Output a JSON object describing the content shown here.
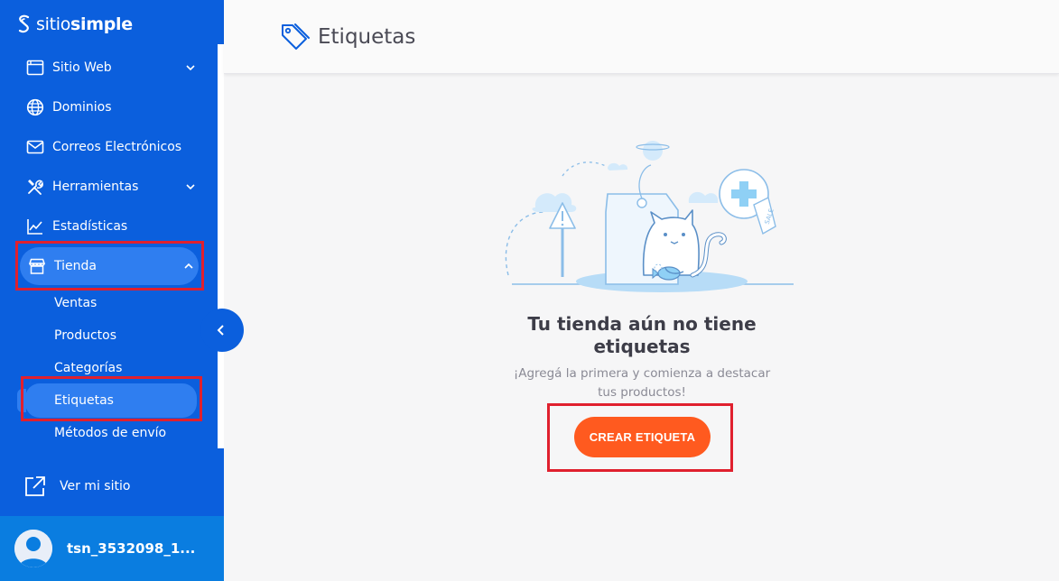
{
  "brand": {
    "prefix": "sitio",
    "bold": "simple"
  },
  "sidebar": {
    "items": [
      {
        "label": "Sitio Web",
        "icon": "browser-window-icon",
        "has_chevron": true
      },
      {
        "label": "Dominios",
        "icon": "globe-icon",
        "has_chevron": false
      },
      {
        "label": "Correos Electrónicos",
        "icon": "envelope-icon",
        "has_chevron": false
      },
      {
        "label": "Herramientas",
        "icon": "tools-icon",
        "has_chevron": true
      },
      {
        "label": "Estadísticas",
        "icon": "chart-line-icon",
        "has_chevron": false
      },
      {
        "label": "Tienda",
        "icon": "store-icon",
        "has_chevron": true,
        "expanded": true,
        "active": true
      }
    ],
    "store_subitems": [
      {
        "label": "Ventas"
      },
      {
        "label": "Productos"
      },
      {
        "label": "Categorías"
      },
      {
        "label": "Etiquetas",
        "active": true
      },
      {
        "label": "Métodos de envío"
      }
    ],
    "view_site": "Ver mi sitio",
    "user": "tsn_3532098_1..."
  },
  "header": {
    "title": "Etiquetas",
    "icon": "tag-icon"
  },
  "empty_state": {
    "title": "Tu tienda aún no tiene etiquetas",
    "subtitle": "¡Agregá la primera y comienza a destacar tus productos!",
    "cta": "CREAR ETIQUETA",
    "illustration_badge": "SALE"
  },
  "colors": {
    "sidebar": "#0b5fdd",
    "active_item": "#2f7ef0",
    "user_bar": "#0a7de0",
    "cta": "#ff5a1f",
    "highlight": "#e0202e"
  }
}
